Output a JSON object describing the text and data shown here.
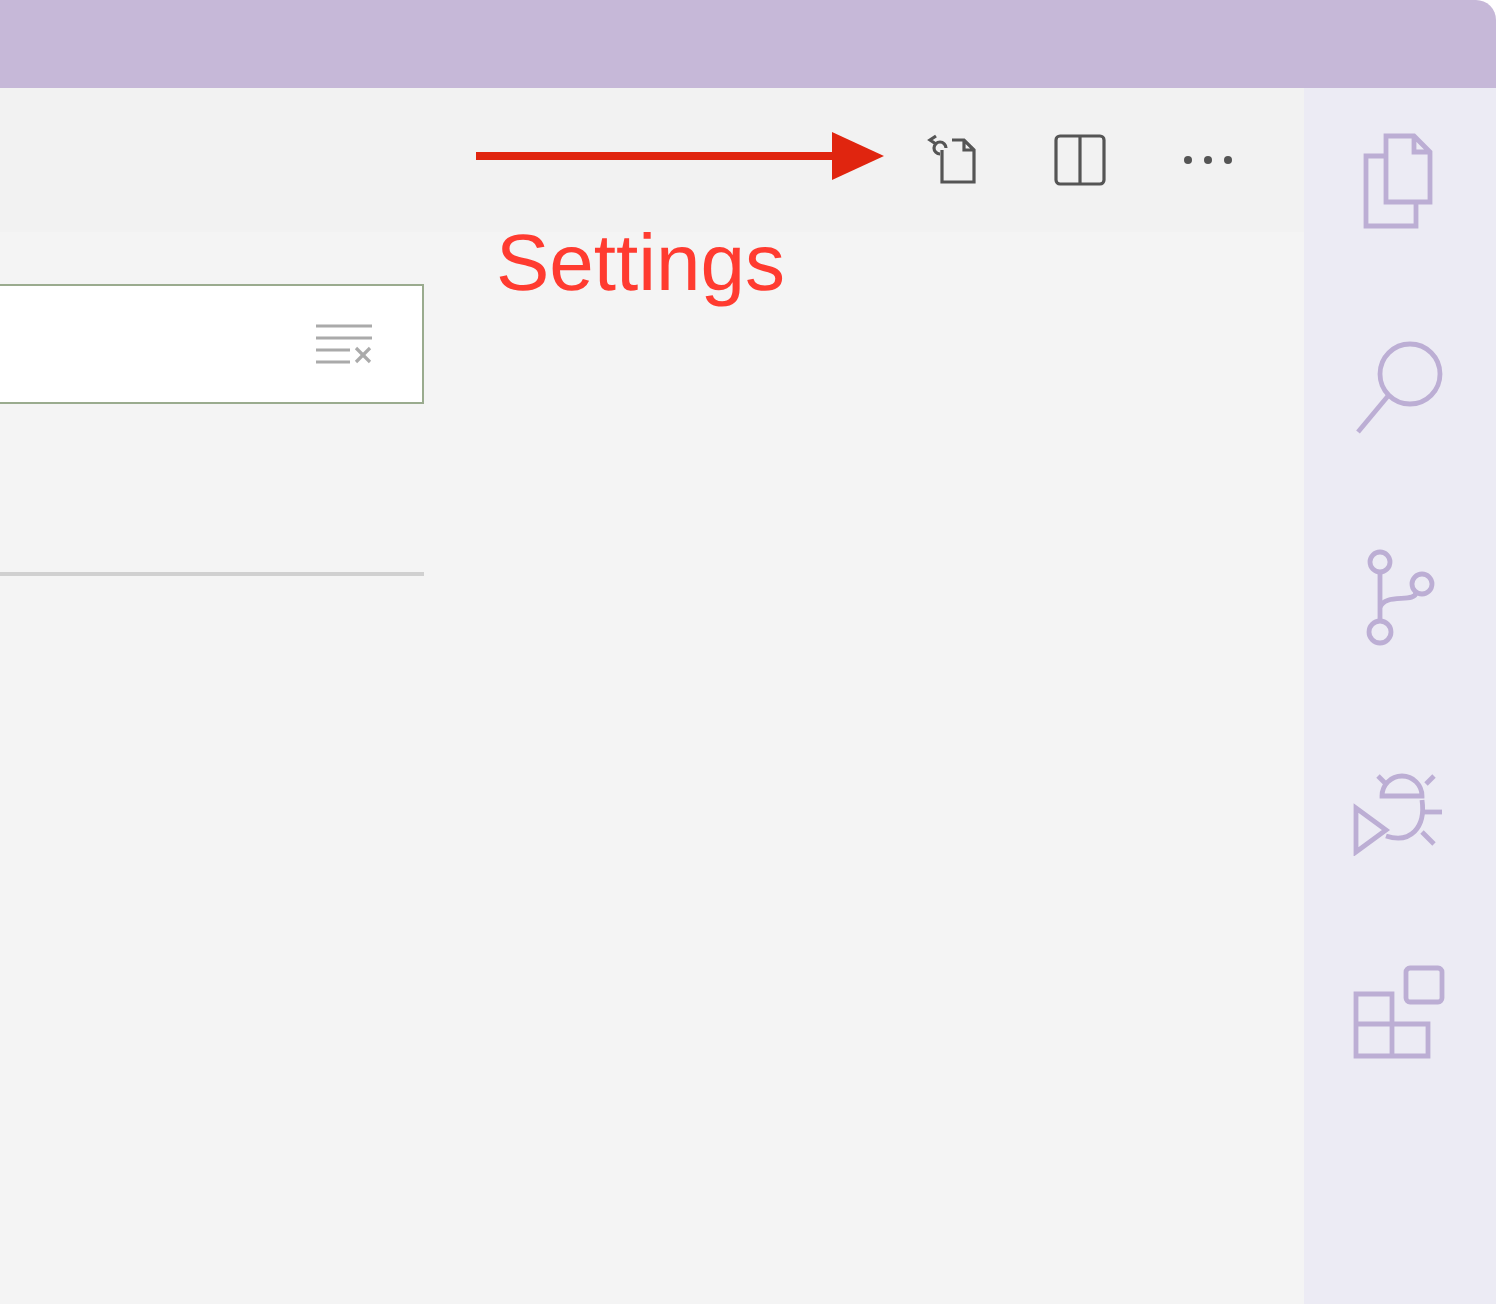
{
  "annotation": {
    "label": "Settings"
  }
}
